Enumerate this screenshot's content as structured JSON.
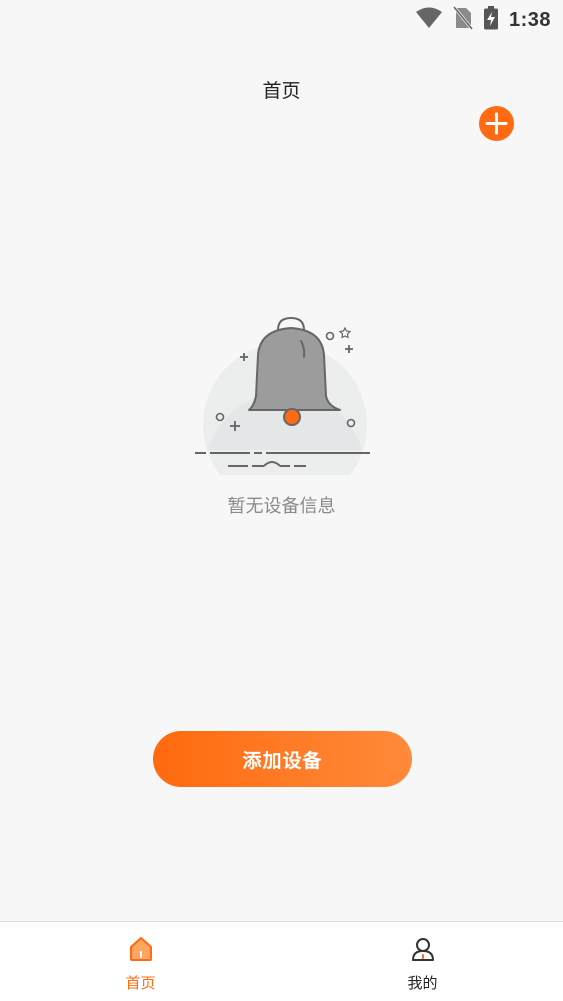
{
  "status_bar": {
    "time": "1:38",
    "icons": [
      "wifi-icon",
      "no-sim-icon",
      "battery-charging-icon"
    ]
  },
  "header": {
    "title": "首页",
    "add_icon": "plus-circle-icon"
  },
  "empty_state": {
    "illustration": "bell-icon",
    "message": "暂无设备信息"
  },
  "actions": {
    "add_device_label": "添加设备"
  },
  "tab_bar": {
    "tabs": [
      {
        "label": "首页",
        "icon": "home-icon",
        "active": true
      },
      {
        "label": "我的",
        "icon": "user-icon",
        "active": false
      }
    ]
  },
  "colors": {
    "accent": "#ff6a13",
    "background": "#f7f7f7",
    "muted_text": "#8a8a8a"
  }
}
